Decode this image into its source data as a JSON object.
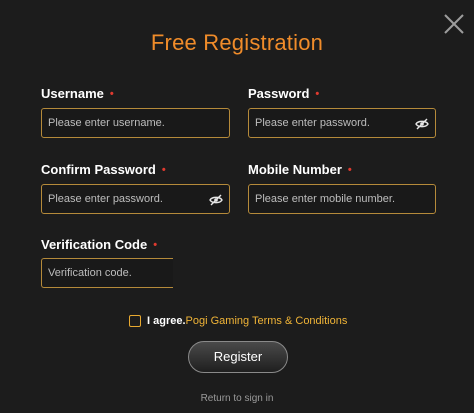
{
  "dialog": {
    "title": "Free Registration",
    "close_icon": "close-icon"
  },
  "form": {
    "username": {
      "label": "Username",
      "required_mark": "•",
      "placeholder": "Please enter username.",
      "value": ""
    },
    "password": {
      "label": "Password",
      "required_mark": "•",
      "placeholder": "Please enter password.",
      "value": "",
      "toggle_icon": "eye-off-icon"
    },
    "confirm_password": {
      "label": "Confirm Password",
      "required_mark": "•",
      "placeholder": "Please enter password.",
      "value": "",
      "toggle_icon": "eye-off-icon"
    },
    "mobile_number": {
      "label": "Mobile Number",
      "required_mark": "•",
      "placeholder": "Please enter mobile number.",
      "value": ""
    },
    "verification_code": {
      "label": "Verification Code",
      "required_mark": "•",
      "placeholder": "Verification code.",
      "value": ""
    }
  },
  "agreement": {
    "checked": false,
    "prefix": "I agree.",
    "link_text": "Pogi Gaming Terms & Conditions"
  },
  "actions": {
    "register_label": "Register",
    "return_label": "Return to sign in"
  },
  "colors": {
    "accent": "#f08c2a",
    "field_border": "#b58a3a",
    "required": "#e03a2f",
    "link": "#f0b437",
    "background": "#1c1c1c"
  }
}
